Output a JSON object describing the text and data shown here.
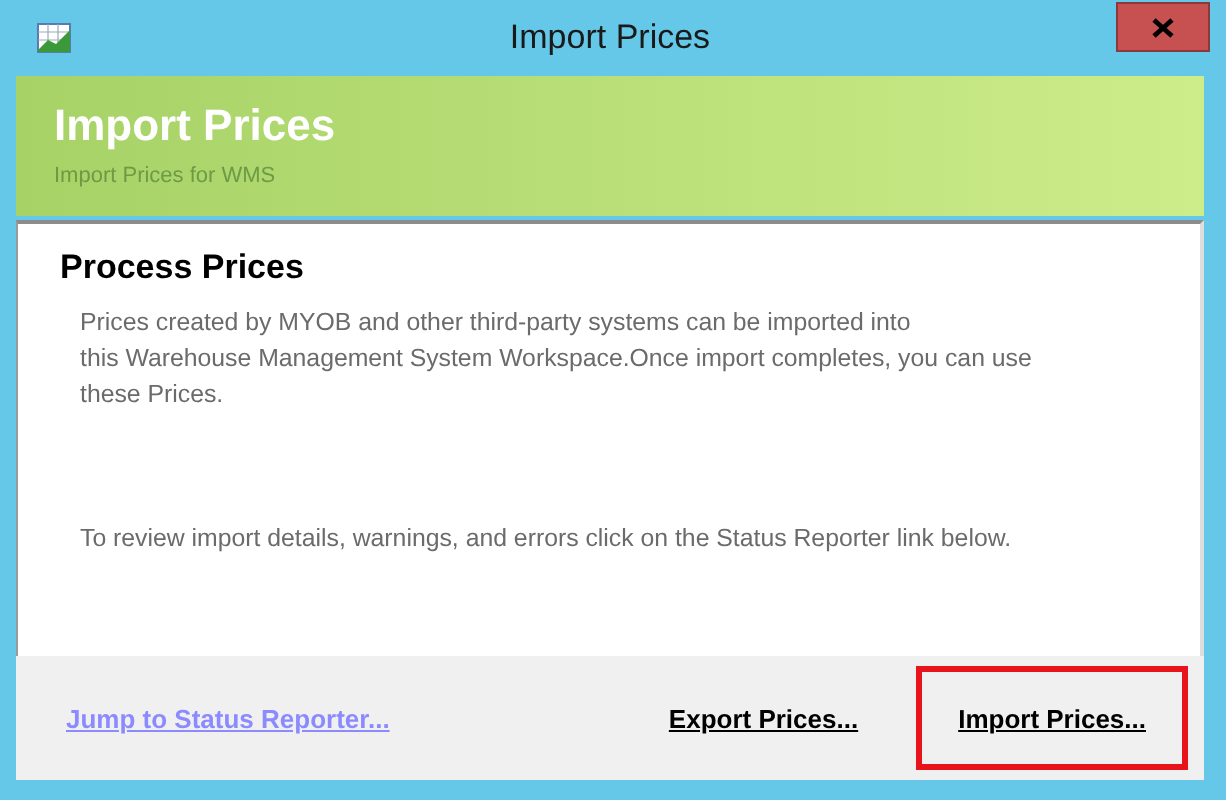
{
  "window": {
    "title": "Import Prices"
  },
  "banner": {
    "title": "Import Prices",
    "subtitle": "Import Prices for WMS"
  },
  "section": {
    "heading": "Process Prices",
    "intro_lines": [
      "Prices created by MYOB and other third-party systems can be imported into",
      "this Warehouse Management System Workspace.Once import completes, you can use",
      "these Prices."
    ],
    "note": "To review import details, warnings, and errors click on the Status Reporter link below."
  },
  "footer": {
    "link": "Jump to Status Reporter...",
    "actions": [
      {
        "label": "Export Prices...",
        "highlighted": false
      },
      {
        "label": "Import Prices...",
        "highlighted": true
      }
    ]
  }
}
